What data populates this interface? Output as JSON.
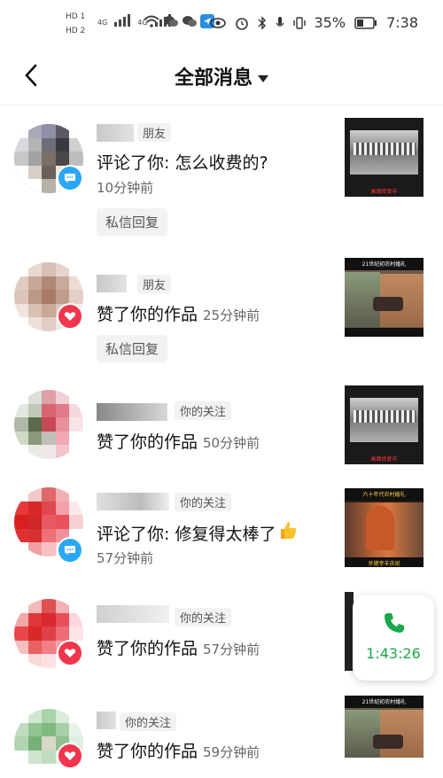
{
  "status_bar": {
    "hd1": "HD 1",
    "hd2": "HD 2",
    "net1": "4G",
    "net2": "4G",
    "battery": "35%",
    "time": "7:38"
  },
  "header": {
    "title": "全部消息",
    "back_icon": "chevron-left-icon",
    "dropdown_icon": "caret-down-icon"
  },
  "notifications": [
    {
      "relation": "朋友",
      "text": "评论了你: 怎么收费的?",
      "time": "10分钟前",
      "reply": "私信回复",
      "type": "comment"
    },
    {
      "relation": "朋友",
      "text": "赞了你的作品",
      "time": "25分钟前",
      "reply": "私信回复",
      "type": "like"
    },
    {
      "relation": "你的关注",
      "text": "赞了你的作品",
      "time": "50分钟前",
      "type": "like"
    },
    {
      "relation": "你的关注",
      "text": "评论了你: 修复得太棒了",
      "time": "57分钟前",
      "type": "comment"
    },
    {
      "relation": "你的关注",
      "text": "赞了你的作品",
      "time": "57分钟前",
      "type": "like"
    },
    {
      "relation": "你的关注",
      "text": "赞了你的作品",
      "time": "59分钟前",
      "type": "like"
    }
  ],
  "thumbnails": {
    "t1_caption": "画面修复中",
    "t2_title": "21世纪初农村婚礼",
    "t4_title": "六十年代农村婚礼",
    "t4_caption": "杀猪宰羊庆祝"
  },
  "call_widget": {
    "icon": "phone-icon",
    "duration": "1:43:26",
    "color": "#1aa84a"
  },
  "colors": {
    "comment_badge": "#2aa8f5",
    "like_badge": "#f0364d"
  }
}
